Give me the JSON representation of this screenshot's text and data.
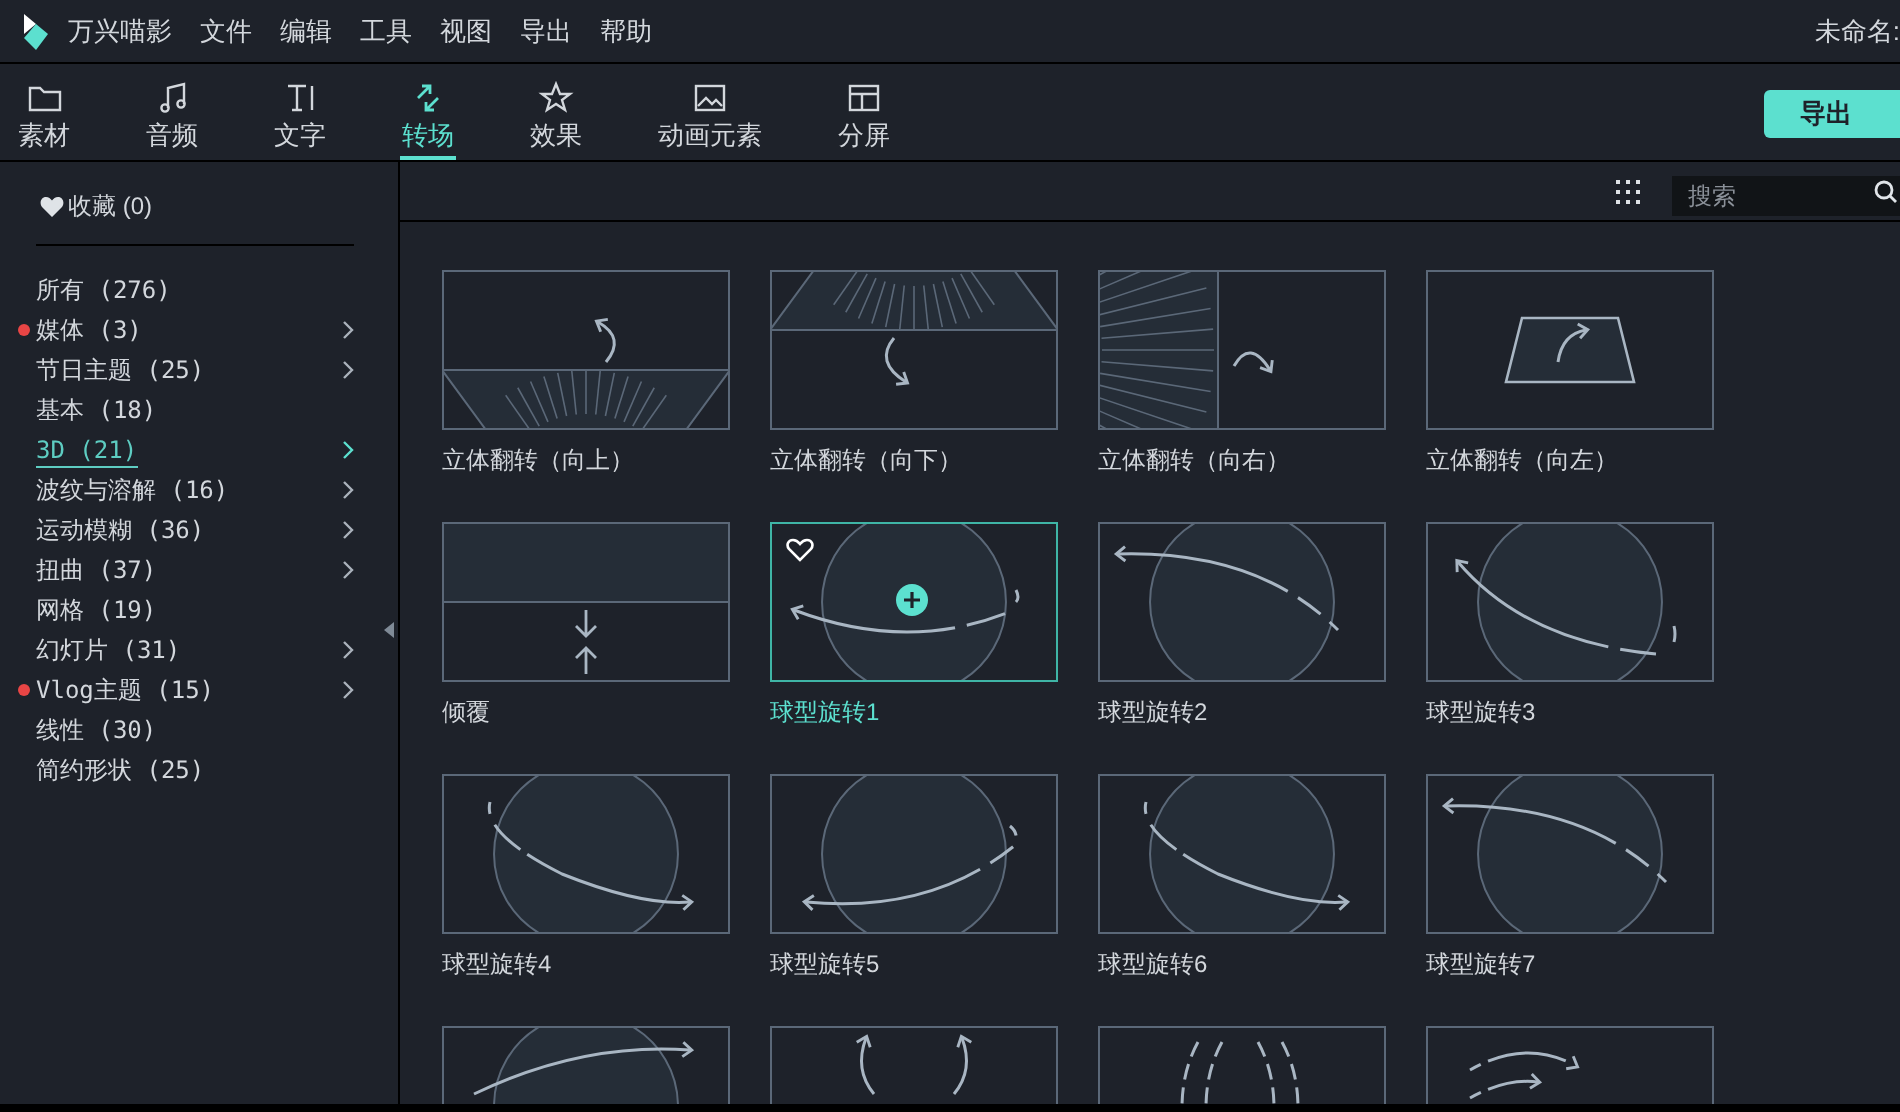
{
  "app": {
    "name": "万兴喵影",
    "project": "未命名:"
  },
  "menu": [
    "文件",
    "编辑",
    "工具",
    "视图",
    "导出",
    "帮助"
  ],
  "tabs": [
    {
      "label": "素材",
      "kind": "folder",
      "selected": false
    },
    {
      "label": "音频",
      "kind": "note",
      "selected": false
    },
    {
      "label": "文字",
      "kind": "text",
      "selected": false
    },
    {
      "label": "转场",
      "kind": "transition",
      "selected": true
    },
    {
      "label": "效果",
      "kind": "star",
      "selected": false
    },
    {
      "label": "动画元素",
      "kind": "image",
      "selected": false
    },
    {
      "label": "分屏",
      "kind": "split",
      "selected": false
    }
  ],
  "export_button": "导出",
  "sidebar": {
    "favorites": "收藏 (0)",
    "items": [
      {
        "label": "所有 (276)",
        "new": false,
        "has_children": false,
        "selected": false
      },
      {
        "label": "媒体 (3)",
        "new": true,
        "has_children": true,
        "selected": false
      },
      {
        "label": "节日主题 (25)",
        "new": false,
        "has_children": true,
        "selected": false
      },
      {
        "label": "基本 (18)",
        "new": false,
        "has_children": false,
        "selected": false
      },
      {
        "label": "3D (21)",
        "new": false,
        "has_children": true,
        "selected": true
      },
      {
        "label": "波纹与溶解 (16)",
        "new": false,
        "has_children": true,
        "selected": false
      },
      {
        "label": "运动模糊 (36)",
        "new": false,
        "has_children": true,
        "selected": false
      },
      {
        "label": "扭曲 (37)",
        "new": false,
        "has_children": true,
        "selected": false
      },
      {
        "label": "网格 (19)",
        "new": false,
        "has_children": false,
        "selected": false
      },
      {
        "label": "幻灯片 (31)",
        "new": false,
        "has_children": true,
        "selected": false
      },
      {
        "label": "Vlog主题 (15)",
        "new": true,
        "has_children": true,
        "selected": false
      },
      {
        "label": "线性 (30)",
        "new": false,
        "has_children": false,
        "selected": false
      },
      {
        "label": "简约形状 (25)",
        "new": false,
        "has_children": false,
        "selected": false
      }
    ]
  },
  "search": {
    "placeholder": "搜索"
  },
  "transitions": [
    {
      "label": "立体翻转（向上）",
      "kind": "flipup",
      "selected": false
    },
    {
      "label": "立体翻转（向下）",
      "kind": "flipdown",
      "selected": false
    },
    {
      "label": "立体翻转（向右）",
      "kind": "flipright",
      "selected": false
    },
    {
      "label": "立体翻转（向左）",
      "kind": "flipleft",
      "selected": false
    },
    {
      "label": "倾覆",
      "kind": "tilt",
      "selected": false
    },
    {
      "label": "球型旋转1",
      "kind": "sphere",
      "selected": true
    },
    {
      "label": "球型旋转2",
      "kind": "sphere",
      "selected": false
    },
    {
      "label": "球型旋转3",
      "kind": "sphere",
      "selected": false
    },
    {
      "label": "球型旋转4",
      "kind": "sphere",
      "selected": false
    },
    {
      "label": "球型旋转5",
      "kind": "sphere",
      "selected": false
    },
    {
      "label": "球型旋转6",
      "kind": "sphere",
      "selected": false
    },
    {
      "label": "球型旋转7",
      "kind": "sphere",
      "selected": false
    },
    {
      "kind": "sphere",
      "selected": false
    },
    {
      "kind": "swirl",
      "selected": false
    },
    {
      "kind": "arcs",
      "selected": false
    },
    {
      "kind": "sweep",
      "selected": false
    }
  ]
}
